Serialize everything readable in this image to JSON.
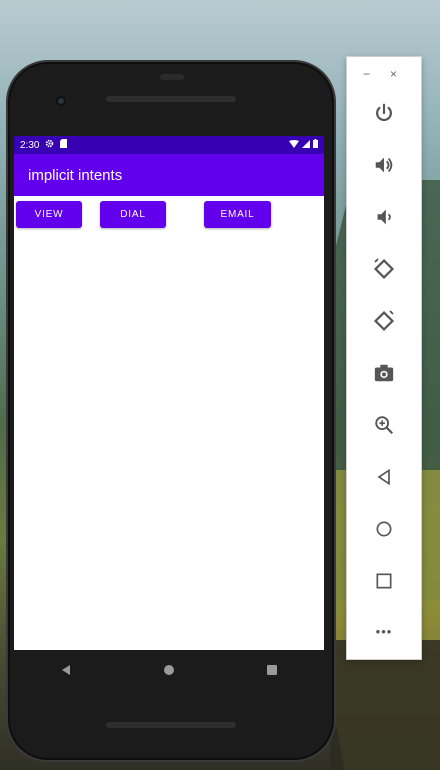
{
  "status_bar": {
    "time": "2:30",
    "gear_icon": "gear-icon",
    "sd_icon": "sdcard-icon",
    "wifi_icon": "wifi-icon",
    "signal_icon": "signal-icon",
    "battery_icon": "battery-icon"
  },
  "app_bar": {
    "title": "implicit intents",
    "color": "#6200ee",
    "status_color": "#3700b3"
  },
  "buttons": {
    "view": "VIEW",
    "dial": "DIAL",
    "email": "EMAIL"
  },
  "nav_bar": {
    "back_icon": "back-icon",
    "home_icon": "home-icon",
    "recents_icon": "recents-icon"
  },
  "emulator_panel": {
    "minimize": "−",
    "close": "×",
    "tools": [
      "power-icon",
      "volume-up-icon",
      "volume-down-icon",
      "rotate-left-icon",
      "rotate-right-icon",
      "camera-icon",
      "zoom-icon",
      "back-icon",
      "home-icon",
      "overview-icon",
      "more-icon"
    ],
    "more_label": "•••"
  }
}
